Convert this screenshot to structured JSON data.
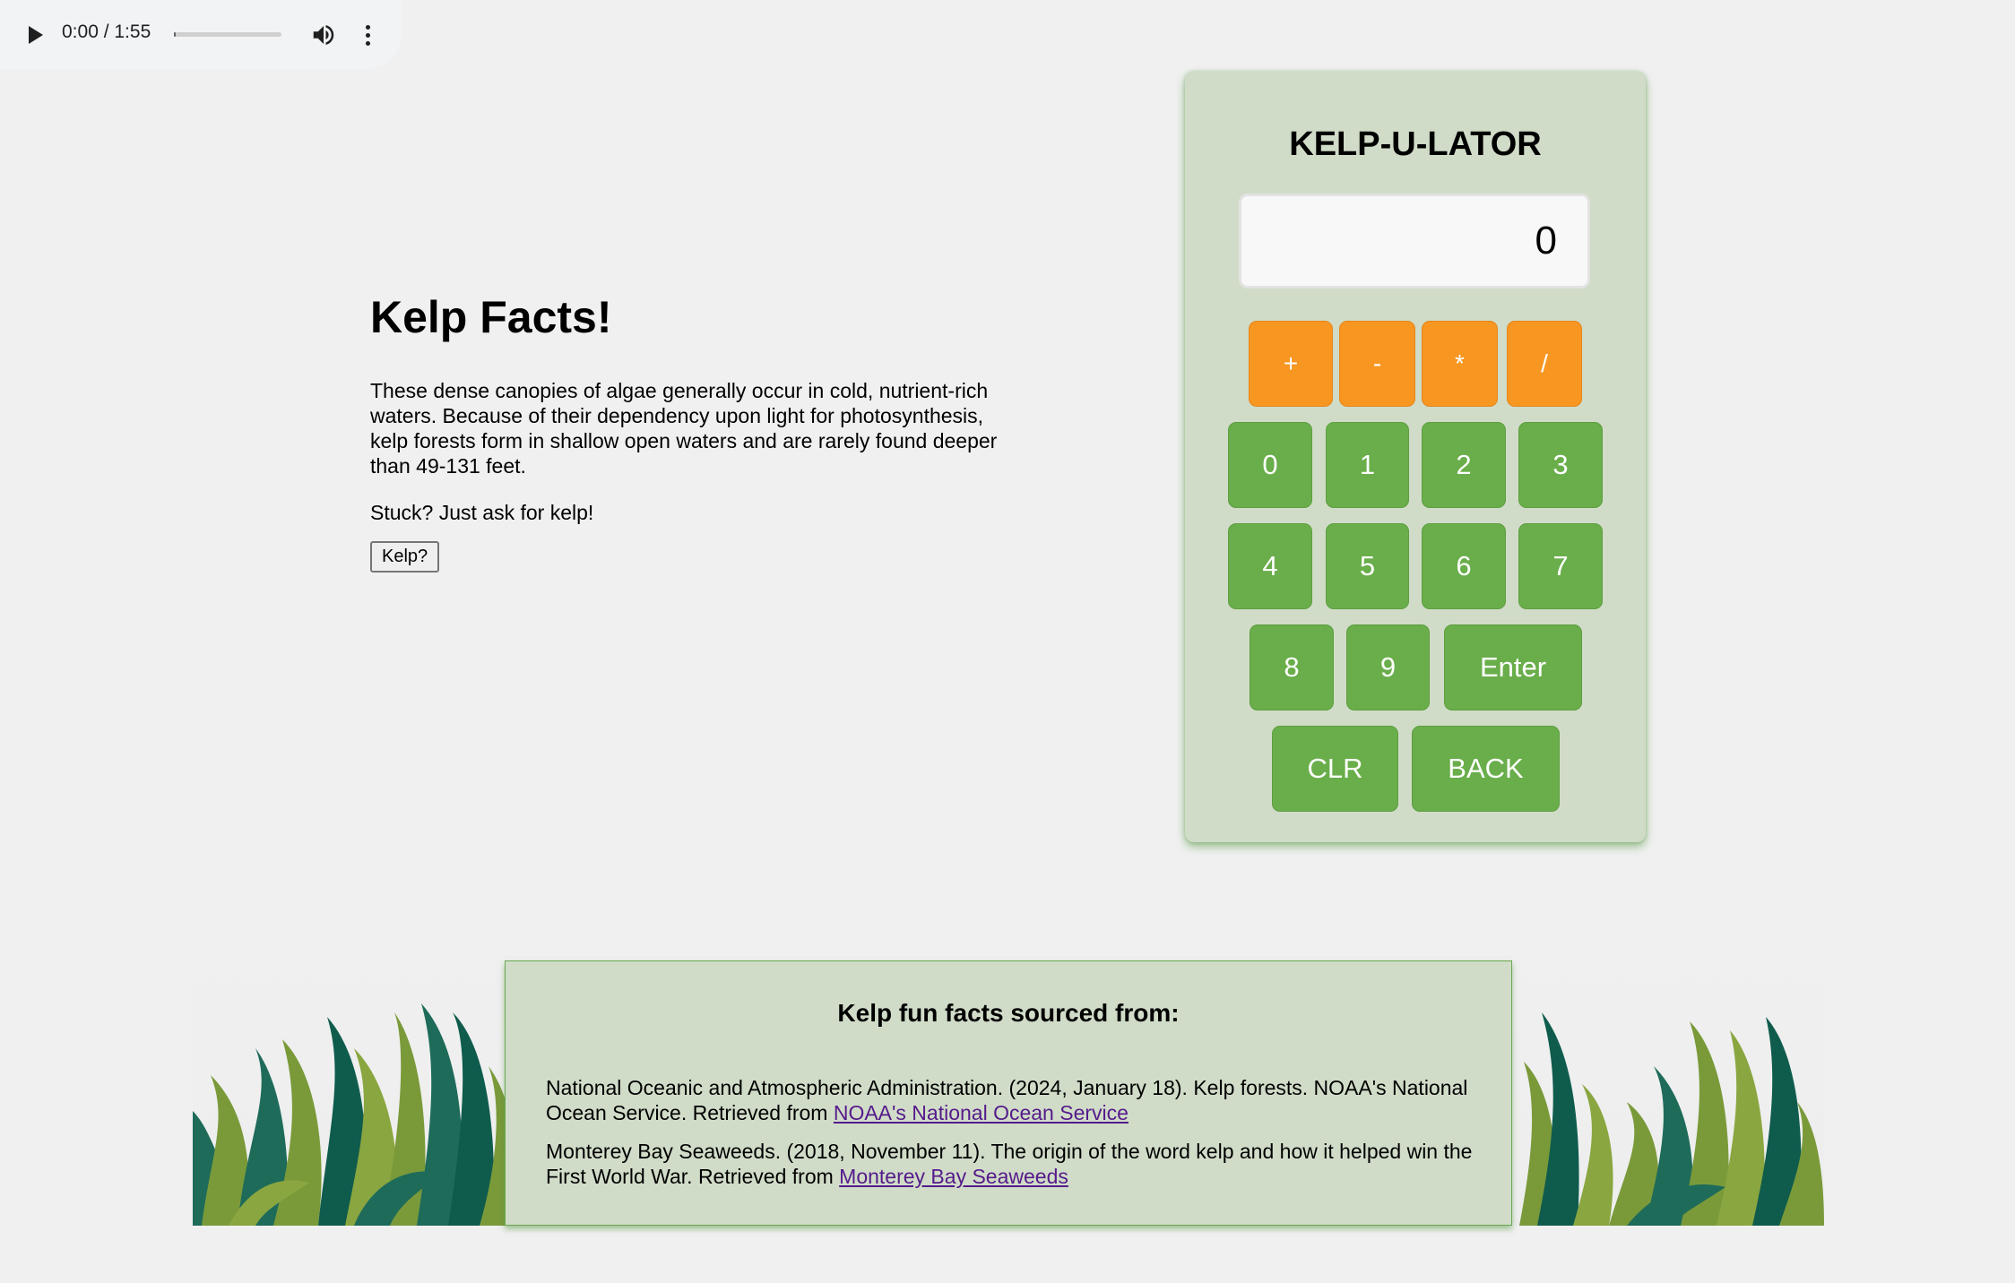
{
  "audio": {
    "time": "0:00 / 1:55",
    "progress": 0,
    "icons": [
      "play-icon",
      "volume-icon",
      "more-options-icon"
    ]
  },
  "facts": {
    "title": "Kelp Facts!",
    "description": "These dense canopies of algae generally occur in cold, nutrient-rich waters. Because of their dependency upon light for photosynthesis, kelp forests form in shallow open waters and are rarely found deeper than 49-131 feet.",
    "stuck": "Stuck? Just ask for kelp!",
    "button_label": "Kelp?"
  },
  "calculator": {
    "title": "KELP-U-LATOR",
    "display": "0",
    "operators": [
      "+",
      "-",
      "*",
      "/"
    ],
    "row1": [
      "0",
      "1",
      "2",
      "3"
    ],
    "row2": [
      "4",
      "5",
      "6",
      "7"
    ],
    "row3": [
      "8",
      "9",
      "Enter"
    ],
    "row4": [
      "CLR",
      "BACK"
    ],
    "colors": {
      "operator": "#f79621",
      "number": "#69ae4a",
      "panel": "#d0dcc8"
    }
  },
  "sources": {
    "heading": "Kelp fun facts sourced from:",
    "citations": [
      {
        "text": "National Oceanic and Atmospheric Administration. (2024, January 18). Kelp forests. NOAA's National Ocean Service. Retrieved from ",
        "link": "NOAA's National Ocean Service"
      },
      {
        "text": "Monterey Bay Seaweeds. (2018, November 11). The origin of the word kelp and how it helped win the First World War. Retrieved from ",
        "link": "Monterey Bay Seaweeds"
      }
    ]
  }
}
